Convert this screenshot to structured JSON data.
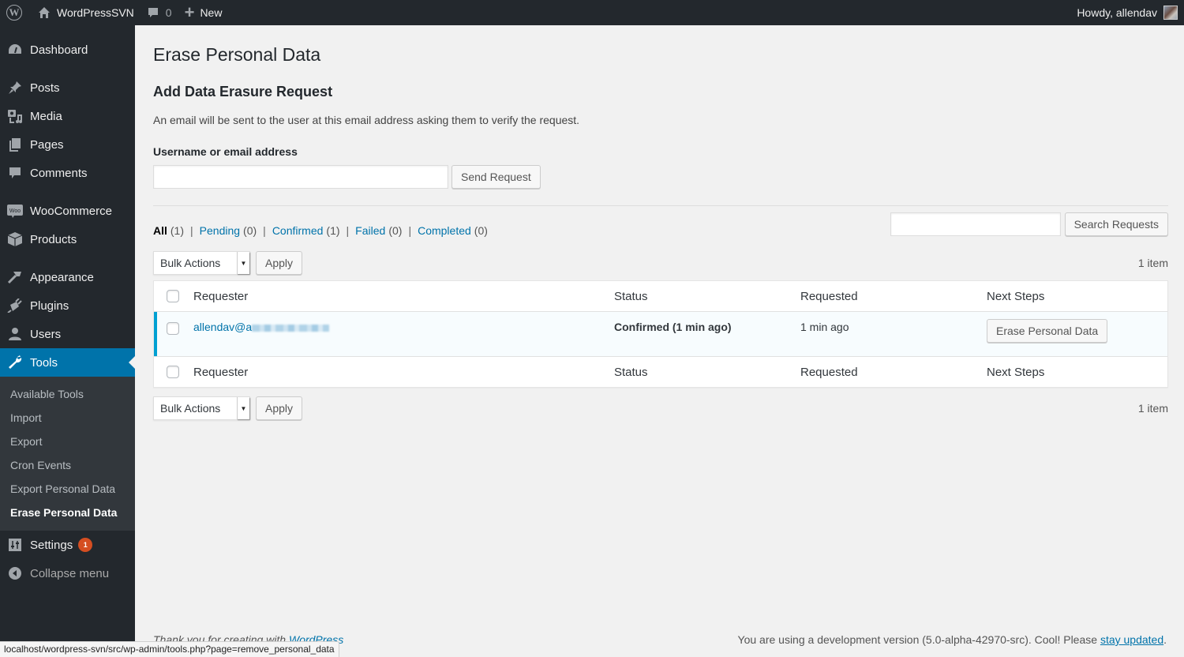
{
  "adminbar": {
    "wp_logo": "wordpress-logo-icon",
    "site_name": "WordPressSVN",
    "comments_count": "0",
    "new_label": "New",
    "greeting": "Howdy, allendav"
  },
  "sidebar": {
    "items": [
      {
        "label": "Dashboard",
        "icon": "dashboard-icon"
      },
      {
        "label": "Posts",
        "icon": "pin-icon"
      },
      {
        "label": "Media",
        "icon": "media-icon"
      },
      {
        "label": "Pages",
        "icon": "pages-icon"
      },
      {
        "label": "Comments",
        "icon": "comment-icon"
      },
      {
        "label": "WooCommerce",
        "icon": "woo-icon"
      },
      {
        "label": "Products",
        "icon": "box-icon"
      },
      {
        "label": "Appearance",
        "icon": "brush-icon"
      },
      {
        "label": "Plugins",
        "icon": "plug-icon"
      },
      {
        "label": "Users",
        "icon": "user-icon"
      },
      {
        "label": "Tools",
        "icon": "wrench-icon"
      },
      {
        "label": "Settings",
        "icon": "sliders-icon",
        "badge": "1"
      }
    ],
    "submenu": [
      "Available Tools",
      "Import",
      "Export",
      "Cron Events",
      "Export Personal Data",
      "Erase Personal Data"
    ],
    "collapse_label": "Collapse menu"
  },
  "main": {
    "page_title": "Erase Personal Data",
    "section_title": "Add Data Erasure Request",
    "description": "An email will be sent to the user at this email address asking them to verify the request.",
    "field_label": "Username or email address",
    "field_value": "",
    "send_button": "Send Request",
    "filters": [
      {
        "label": "All",
        "count": "(1)",
        "current": true
      },
      {
        "label": "Pending",
        "count": "(0)"
      },
      {
        "label": "Confirmed",
        "count": "(1)"
      },
      {
        "label": "Failed",
        "count": "(0)"
      },
      {
        "label": "Completed",
        "count": "(0)"
      }
    ],
    "search_value": "",
    "search_button": "Search Requests",
    "bulk_actions": "Bulk Actions",
    "apply": "Apply",
    "item_count": "1 item",
    "columns": [
      "Requester",
      "Status",
      "Requested",
      "Next Steps"
    ],
    "rows": [
      {
        "requester": "allendav@a",
        "status": "Confirmed (1 min ago)",
        "requested": "1 min ago",
        "next_step": "Erase Personal Data"
      }
    ]
  },
  "footer": {
    "thanks_prefix": "Thank you for creating with ",
    "thanks_link": "WordPress",
    "version_text": "You are using a development version (5.0-alpha-42970-src). Cool! Please ",
    "version_link": "stay updated",
    "version_suffix": "."
  },
  "statusbar": {
    "url": "localhost/wordpress-svn/src/wp-admin/tools.php?page=remove_personal_data"
  }
}
